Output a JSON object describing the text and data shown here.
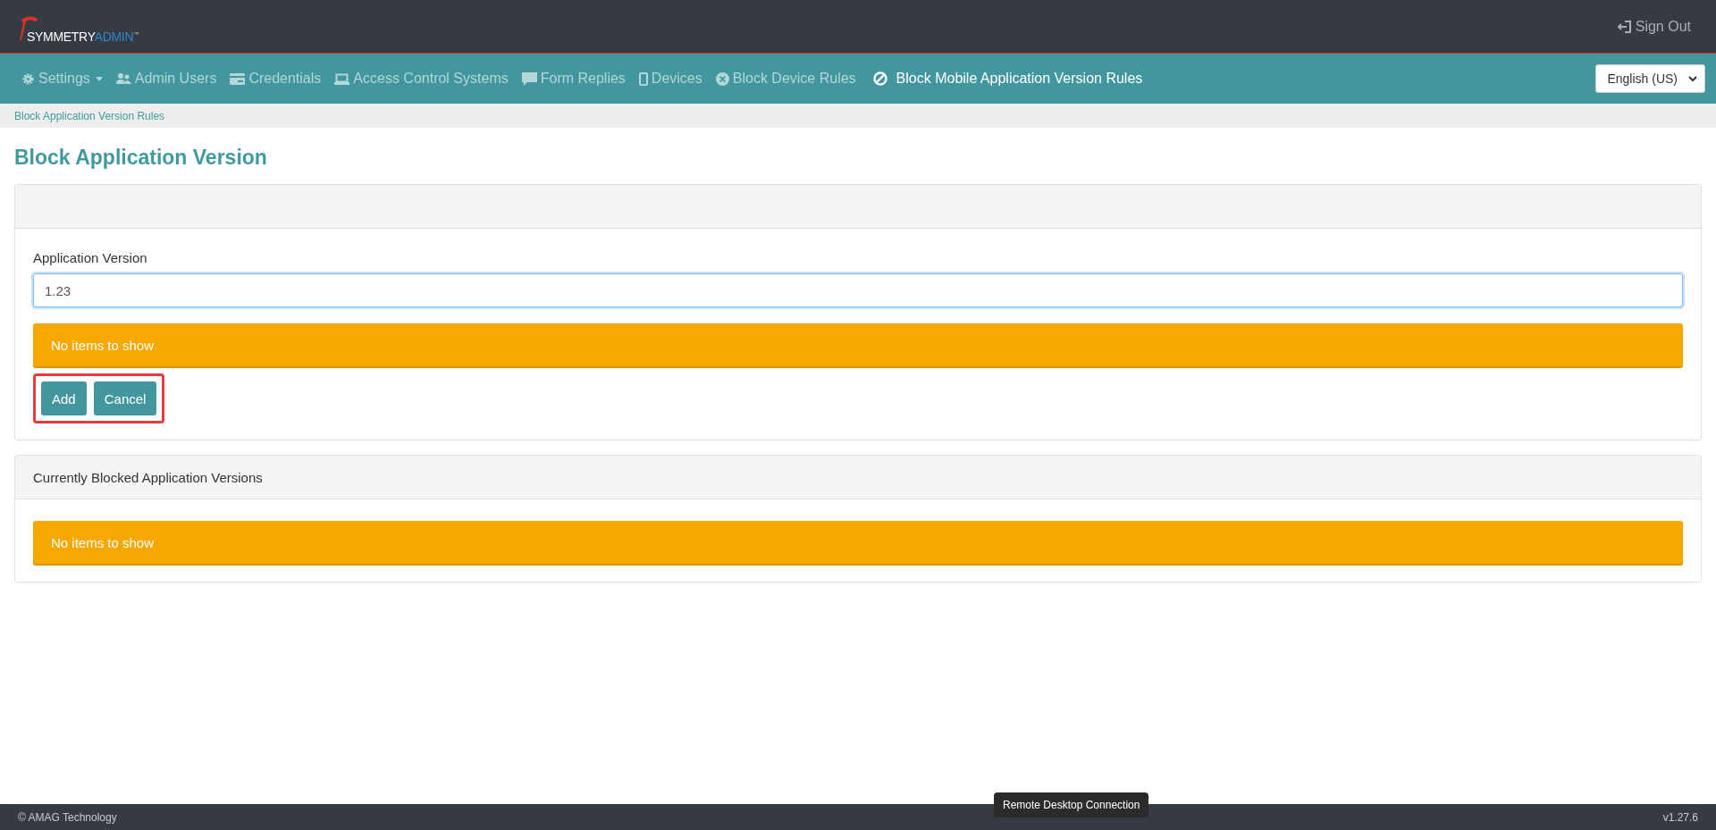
{
  "header": {
    "logo": {
      "brand": "SYMMETRY",
      "product": "ADMIN",
      "mark": "™"
    },
    "sign_out": "Sign Out"
  },
  "nav": {
    "items": [
      {
        "label": "Settings",
        "dropdown": true,
        "selected": false
      },
      {
        "label": "Admin Users",
        "dropdown": false,
        "selected": false
      },
      {
        "label": "Credentials",
        "dropdown": false,
        "selected": false
      },
      {
        "label": "Access Control Systems",
        "dropdown": false,
        "selected": false
      },
      {
        "label": "Form Replies",
        "dropdown": false,
        "selected": false
      },
      {
        "label": "Devices",
        "dropdown": false,
        "selected": false
      },
      {
        "label": "Block Device Rules",
        "dropdown": false,
        "selected": false
      },
      {
        "label": "Block Mobile Application Version Rules",
        "dropdown": false,
        "selected": true
      }
    ],
    "language": "English (US)"
  },
  "breadcrumb": "Block Application Version Rules",
  "title": "Block Application Version",
  "form_card": {
    "field": {
      "label": "Application Version",
      "value": "1.23",
      "focused": true
    },
    "alert": "No items to show",
    "buttons": [
      "Add",
      "Cancel"
    ],
    "highlighted": true
  },
  "blocked_card": {
    "heading": "Currently Blocked Application Versions",
    "alert": "No items to show"
  },
  "tooltip": "Remote Desktop Connection",
  "footer": {
    "copyright": "© AMAG Technology",
    "version": "v1.27.6"
  }
}
